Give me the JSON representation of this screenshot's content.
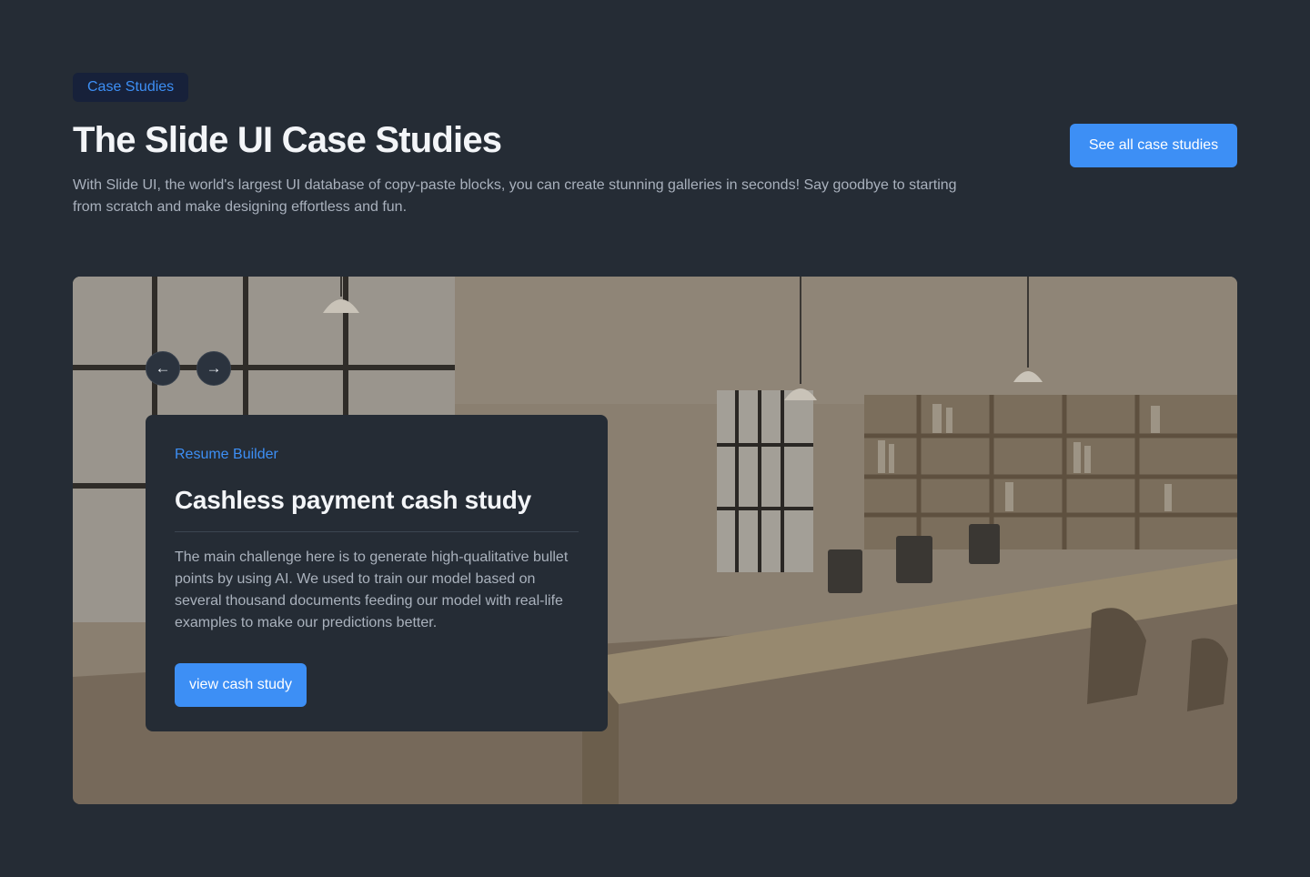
{
  "header": {
    "badge": "Case Studies",
    "title": "The Slide UI Case Studies",
    "description": "With Slide UI, the world's largest UI database of copy-paste blocks, you can create stunning galleries in seconds! Say goodbye to starting from scratch and make designing effortless and fun.",
    "see_all_label": "See all case studies"
  },
  "slider": {
    "prev_icon": "←",
    "next_icon": "→",
    "card": {
      "tag": "Resume Builder",
      "title": "Cashless payment cash study",
      "body": "The main challenge here is to generate high-qualitative bullet points by using AI. We used to train our model based on several thousand documents feeding our model with real-life examples to make our predictions better.",
      "button_label": "view cash study"
    }
  },
  "colors": {
    "background": "#252c35",
    "accent": "#3d8ff5",
    "badge_bg": "#17213a"
  }
}
